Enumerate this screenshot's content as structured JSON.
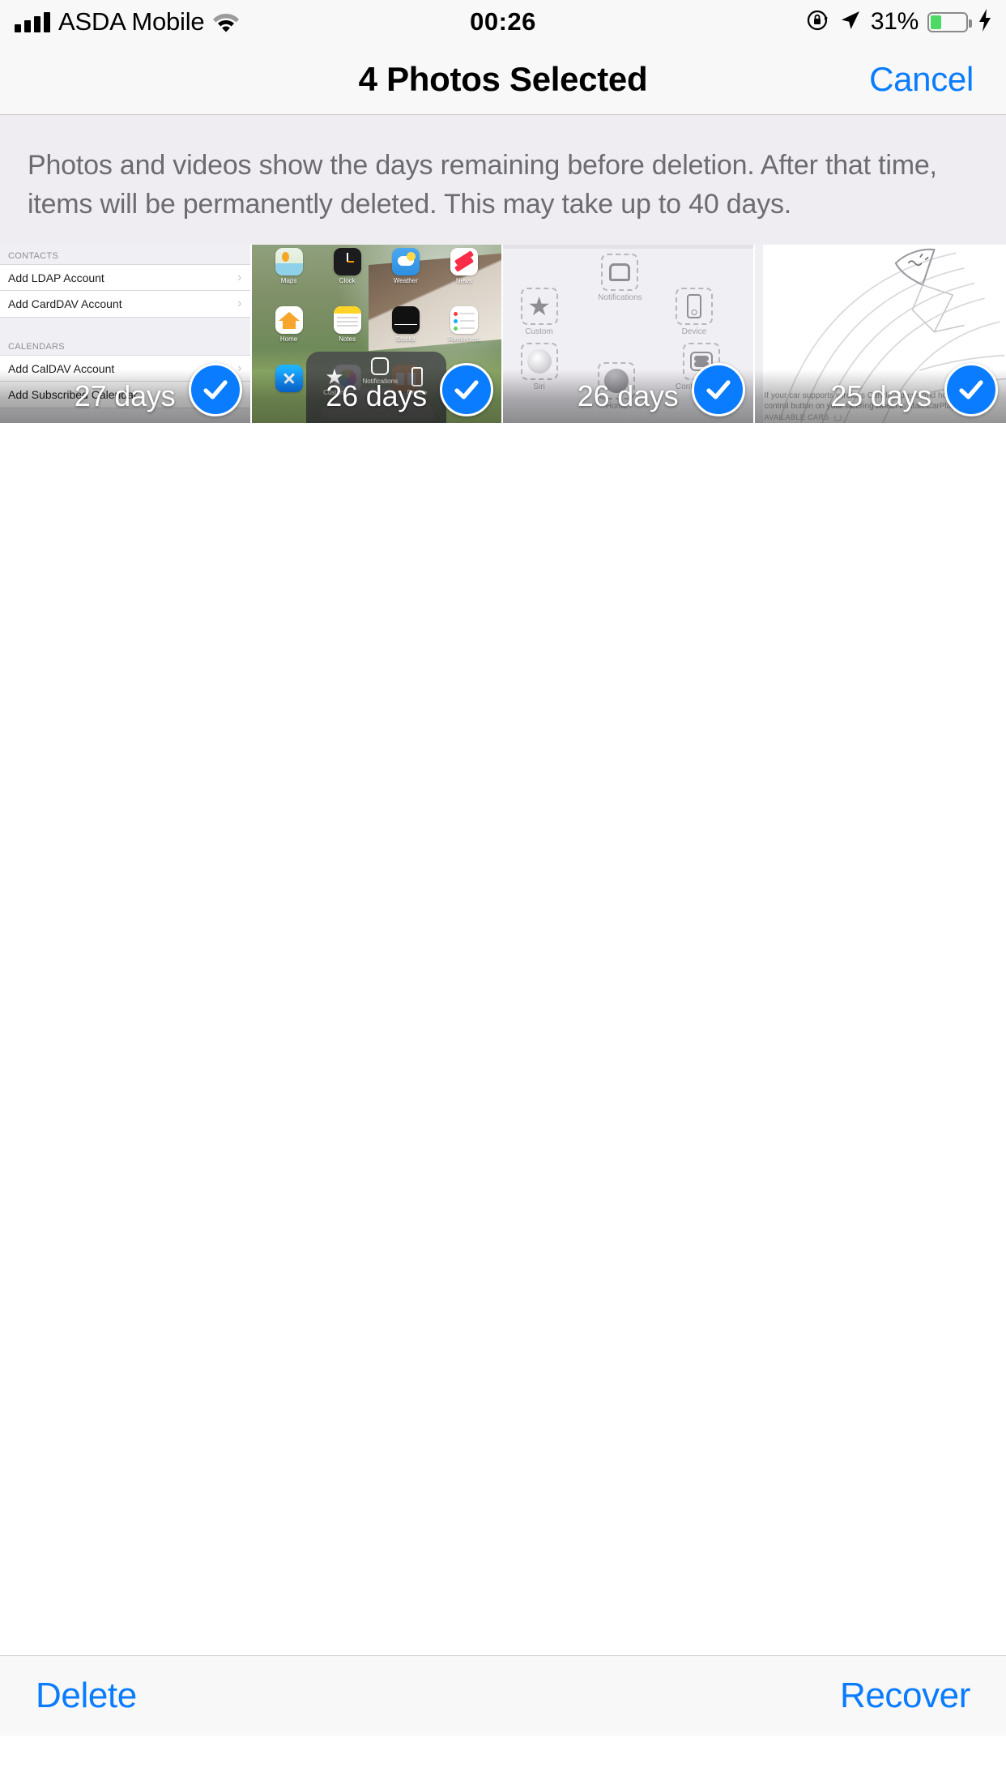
{
  "status_bar": {
    "carrier": "ASDA Mobile",
    "time": "00:26",
    "battery_percent": "31%",
    "battery_level": 31,
    "icons": [
      "signal-bars-icon",
      "wifi-icon",
      "rotation-lock-icon",
      "location-arrow-icon",
      "battery-icon",
      "charging-bolt-icon"
    ]
  },
  "nav_bar": {
    "title": "4 Photos Selected",
    "cancel_label": "Cancel"
  },
  "info_banner": {
    "text": "Photos and videos show the days remaining before deletion. After that time, items will be permanently deleted. This may take up to 40 days."
  },
  "photos": [
    {
      "days_label": "27 days",
      "selected": true,
      "kind": "settings-accounts-screenshot",
      "content": {
        "sections": [
          {
            "header": "CONTACTS",
            "rows": [
              "Add LDAP Account",
              "Add CardDAV Account"
            ]
          },
          {
            "header": "CALENDARS",
            "rows": [
              "Add CalDAV Account",
              "Add Subscribed Calendar"
            ]
          }
        ]
      }
    },
    {
      "days_label": "26 days",
      "selected": true,
      "kind": "home-screen-screenshot",
      "content": {
        "apps": [
          "Maps",
          "Clock",
          "Weather",
          "News",
          "Home",
          "Notes",
          "Stocks",
          "Reminders",
          "",
          "",
          "",
          ""
        ],
        "overlay_items": [
          "Custom",
          "Notifications",
          "Device"
        ]
      }
    },
    {
      "days_label": "26 days",
      "selected": true,
      "kind": "assistivetouch-customize-screenshot",
      "content": {
        "nodes": [
          "Notifications",
          "Custom",
          "Device",
          "Siri",
          "Home",
          "Control Centre"
        ]
      }
    },
    {
      "days_label": "25 days",
      "selected": true,
      "kind": "carplay-setup-screenshot",
      "content": {
        "caption": "If your car supports wireless CarPlay, press and hold the voice control button on your steering wheel to start CarPlay setup.",
        "section_header": "AVAILABLE CARS"
      }
    }
  ],
  "toolbar": {
    "delete_label": "Delete",
    "recover_label": "Recover"
  },
  "colors": {
    "accent_blue": "#0a7cff",
    "banner_bg": "#efedf2",
    "bar_bg": "#f8f8f8",
    "battery_green": "#4cd964"
  }
}
